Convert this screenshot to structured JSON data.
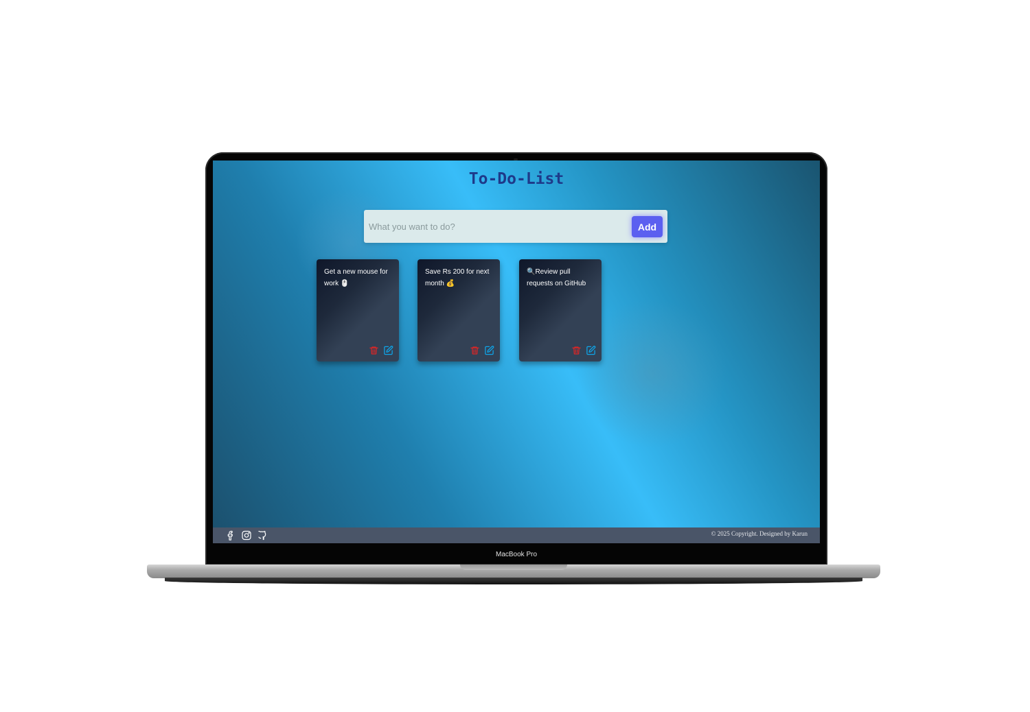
{
  "app": {
    "title": "To-Do-List"
  },
  "input": {
    "placeholder": "What you want to do?",
    "value": "",
    "add_label": "Add"
  },
  "tasks": [
    {
      "text": "Get a new mouse for work 🖱️"
    },
    {
      "text": "Save Rs 200 for next month 💰"
    },
    {
      "text": "🔍Review pull requests on GitHub"
    }
  ],
  "footer": {
    "copyright": "© 2025 Copyright. Designed by Karun",
    "socials": [
      "facebook-icon",
      "instagram-icon",
      "github-icon"
    ]
  },
  "device": {
    "label": "MacBook Pro"
  },
  "colors": {
    "title": "#1e3a8a",
    "add_button": "#5b5ff0",
    "delete_icon": "#dc2626",
    "edit_icon": "#0ea5e9",
    "footer": "#4a5568"
  }
}
